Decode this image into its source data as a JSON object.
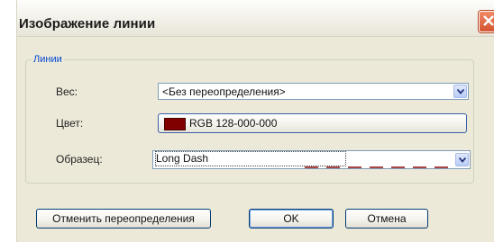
{
  "window": {
    "title": "Изображение линии"
  },
  "group": {
    "legend": "Линии"
  },
  "fields": {
    "weight_label": "Вес:",
    "weight_value": "<Без переопределения>",
    "color_label": "Цвет:",
    "color_value": "RGB 128-000-000",
    "color_swatch": "#800000",
    "pattern_label": "Образец:",
    "pattern_value": "Long Dash"
  },
  "buttons": {
    "reset": "Отменить переопределения",
    "ok": "OK",
    "cancel": "Отмена"
  },
  "icons": [
    "close-icon",
    "chevron-down-icon"
  ]
}
